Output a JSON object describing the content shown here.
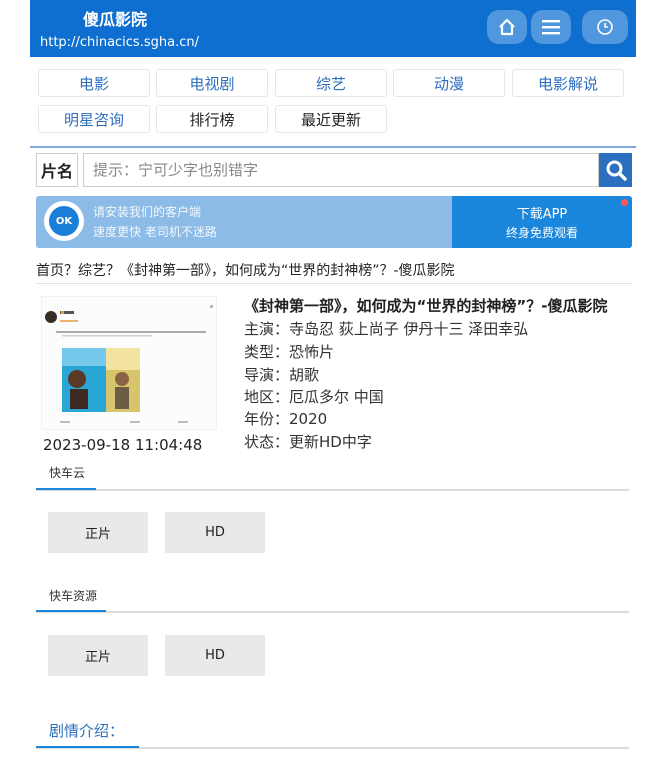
{
  "header": {
    "site_title": "傻瓜影院",
    "site_url": "http://chinacics.sgha.cn/",
    "icons": [
      "home-icon",
      "menu-icon",
      "clock-icon"
    ]
  },
  "nav": {
    "row1": [
      "电影",
      "电视剧",
      "综艺",
      "动漫",
      "电影解说"
    ],
    "row2": [
      "明星咨询",
      "排行榜",
      "最近更新"
    ]
  },
  "search": {
    "label": "片名",
    "placeholder": "提示：宁可少字也别错字",
    "value": ""
  },
  "banner": {
    "logo_text": "OK",
    "line1": "请安装我们的客户端",
    "line2": "速度更快 老司机不迷路",
    "cta_title": "下载APP",
    "cta_sub": "终身免费观看"
  },
  "breadcrumb": "首页？综艺？《封神第一部》，如何成为“世界的封神榜”？-傻瓜影院",
  "movie": {
    "title": "《封神第一部》，如何成为“世界的封神榜”？-傻瓜影院",
    "cast": "主演：寺岛忍 荻上尚子 伊丹十三 泽田幸弘",
    "genre": "类型：恐怖片",
    "director": "导演：胡歌",
    "region": "地区：厄瓜多尔  中国",
    "year": "年份：2020",
    "status": "状态：更新HD中字",
    "update_time": "2023-09-18 11:04:48"
  },
  "sources": [
    {
      "name": "快车云",
      "episodes": [
        "正片",
        "HD"
      ]
    },
    {
      "name": "快车资源",
      "episodes": [
        "正片",
        "HD"
      ]
    }
  ],
  "plot_label": "剧情介绍：",
  "colors": {
    "header_bg": "#0f6fd0",
    "accent": "#1a86dc",
    "link_blue": "#2c6fbe",
    "banner_bg": "#8bbbe6"
  }
}
